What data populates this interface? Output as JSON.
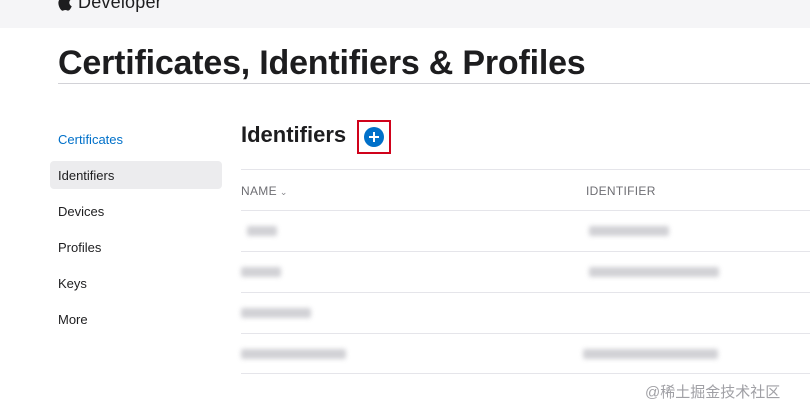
{
  "brand": {
    "name": "Developer",
    "logo_icon": "apple-logo-icon"
  },
  "page": {
    "title": "Certificates, Identifiers & Profiles"
  },
  "sidebar": {
    "items": [
      {
        "label": "Certificates",
        "state": "link"
      },
      {
        "label": "Identifiers",
        "state": "active"
      },
      {
        "label": "Devices",
        "state": "normal"
      },
      {
        "label": "Profiles",
        "state": "normal"
      },
      {
        "label": "Keys",
        "state": "normal"
      },
      {
        "label": "More",
        "state": "normal"
      }
    ]
  },
  "section": {
    "title": "Identifiers",
    "add_icon": "plus-circle-icon",
    "highlight_color": "#d0021b"
  },
  "table": {
    "columns": [
      {
        "label": "NAME",
        "sort_icon": "chevron-down-icon"
      },
      {
        "label": "IDENTIFIER"
      }
    ],
    "rows": [
      {
        "name": "",
        "identifier": "",
        "note": "blurred/redacted"
      },
      {
        "name": "",
        "identifier": "",
        "note": "blurred/redacted"
      },
      {
        "name": "",
        "identifier": "",
        "note": "blurred/redacted"
      },
      {
        "name": "",
        "identifier": "",
        "note": "blurred/redacted"
      }
    ]
  },
  "watermark": {
    "text": "@稀土掘金技术社区"
  },
  "colors": {
    "link": "#0070c9",
    "accent": "#0070c9",
    "active_bg": "#ececee"
  }
}
